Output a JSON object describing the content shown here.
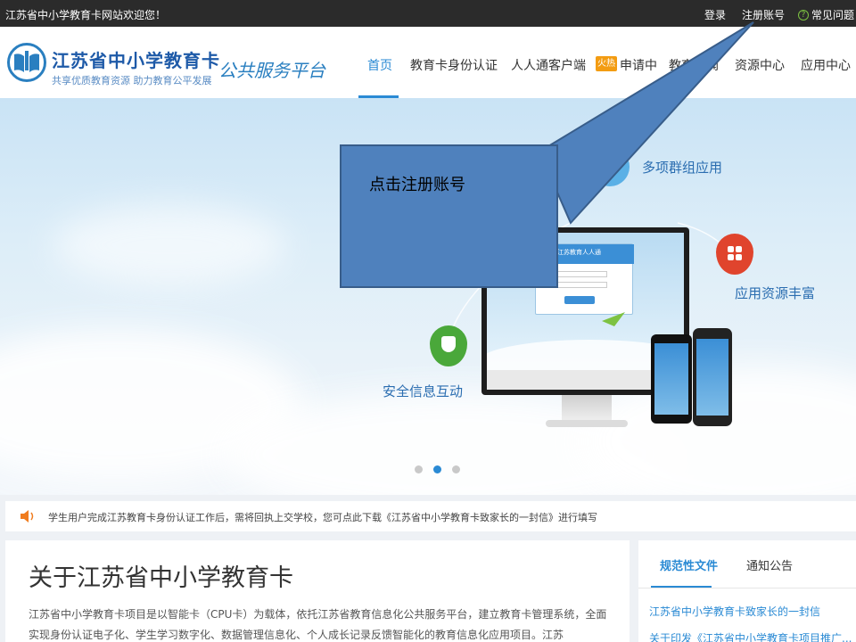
{
  "topbar": {
    "welcome": "江苏省中小学教育卡网站欢迎您！",
    "login": "登录",
    "register": "注册账号",
    "faq": "常见问题"
  },
  "header": {
    "title": "江苏省中小学教育卡",
    "subtitle": "共享优质教育资源  助力教育公平发展",
    "slogan": "公共服务平台"
  },
  "nav": {
    "home": "首页",
    "auth": "教育卡身份认证",
    "client": "人人通客户端",
    "hot_tag": "火热",
    "apply": "申请中",
    "news": "教育新闻",
    "resources": "资源中心",
    "apps": "应用中心"
  },
  "banner": {
    "label_group": "多项群组应用",
    "label_resources": "应用资源丰富",
    "label_security": "安全信息互动",
    "screen_title": "江苏教育人人通",
    "active_slide": 2,
    "slide_count": 3
  },
  "callout": {
    "text": "点击注册账号"
  },
  "notice": {
    "text": "学生用户完成江苏教育卡身份认证工作后，需将回执上交学校，您可点此下载《江苏省中小学教育卡致家长的一封信》进行填写"
  },
  "about": {
    "title": "关于江苏省中小学教育卡",
    "body": "江苏省中小学教育卡项目是以智能卡（CPU卡）为载体，依托江苏省教育信息化公共服务平台，建立教育卡管理系统，全面实现身份认证电子化、学生学习数字化、数据管理信息化、个人成长记录反馈智能化的教育信息化应用项目。江苏"
  },
  "side": {
    "tab_rules": "规范性文件",
    "tab_notice": "通知公告",
    "link1": "江苏省中小学教育卡致家长的一封信",
    "link2": "关于印发《江苏省中小学教育卡项目推广..."
  },
  "colors": {
    "accent": "#2a8ad4",
    "callout": "#4f81bd",
    "topbar": "#2b2b2b"
  }
}
